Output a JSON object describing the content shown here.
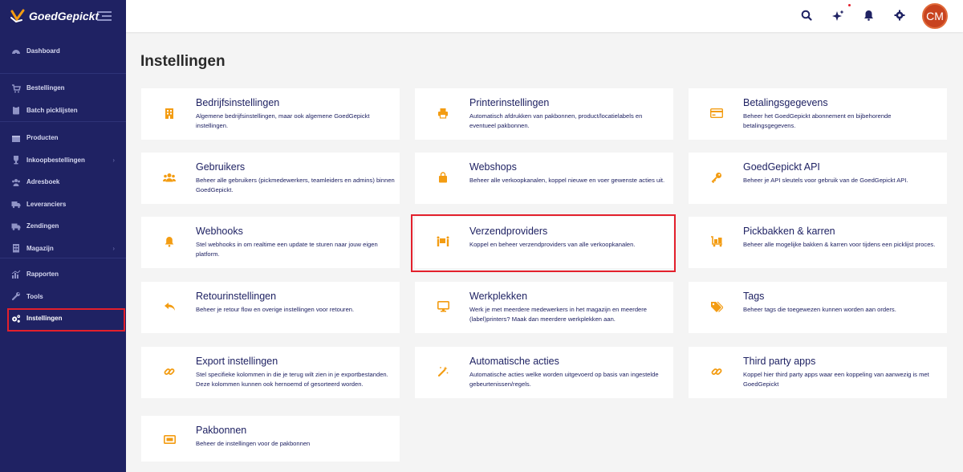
{
  "app": {
    "logo_text": "GoedGepickt"
  },
  "sidebar": {
    "groups": [
      [
        {
          "label": "Dashboard",
          "icon": "dashboard-icon"
        }
      ],
      [
        {
          "label": "Bestellingen",
          "icon": "cart-icon"
        },
        {
          "label": "Batch picklijsten",
          "icon": "clipboard-icon"
        }
      ],
      [
        {
          "label": "Producten",
          "icon": "box-icon"
        },
        {
          "label": "Inkoopbestellingen",
          "icon": "trophy-icon"
        },
        {
          "label": "Adresboek",
          "icon": "users-icon"
        },
        {
          "label": "Leveranciers",
          "icon": "truck-icon"
        },
        {
          "label": "Zendingen",
          "icon": "shipping-icon"
        },
        {
          "label": "Magazijn",
          "icon": "warehouse-icon"
        }
      ],
      [
        {
          "label": "Rapporten",
          "icon": "chart-icon"
        },
        {
          "label": "Tools",
          "icon": "wrench-icon"
        },
        {
          "label": "Instellingen",
          "icon": "cogs-icon"
        }
      ]
    ]
  },
  "header": {
    "avatar_initials": "CM"
  },
  "main": {
    "title": "Instellingen",
    "cards": [
      {
        "title": "Bedrijfsinstellingen",
        "desc": "Algemene bedrijfsinstellingen, maar ook algemene GoedGepickt instellingen.",
        "icon": "building-icon"
      },
      {
        "title": "Printerinstellingen",
        "desc": "Automatisch afdrukken van pakbonnen, product/locatielabels en eventueel pakbonnen.",
        "icon": "printer-icon"
      },
      {
        "title": "Betalingsgegevens",
        "desc": "Beheer het GoedGepickt abonnement en bijbehorende betalingsgegevens.",
        "icon": "credit-card-icon"
      },
      {
        "title": "Gebruikers",
        "desc": "Beheer alle gebruikers (pickmedewerkers, teamleiders en admins) binnen GoedGepickt.",
        "icon": "users-icon"
      },
      {
        "title": "Webshops",
        "desc": "Beheer alle verkoopkanalen, koppel nieuwe en voer gewenste acties uit.",
        "icon": "shopping-bag-icon"
      },
      {
        "title": "GoedGepickt API",
        "desc": "Beheer je API sleutels voor gebruik van de GoedGepickt API.",
        "icon": "key-icon"
      },
      {
        "title": "Webhooks",
        "desc": "Stel webhooks in om realtime een update te sturen naar jouw eigen platform.",
        "icon": "bell-icon"
      },
      {
        "title": "Verzendproviders",
        "desc": "Koppel en beheer verzendproviders van alle verkoopkanalen.",
        "icon": "people-carry-icon"
      },
      {
        "title": "Pickbakken & karren",
        "desc": "Beheer alle mogelijke bakken & karren voor tijdens een picklijst proces.",
        "icon": "dolly-icon"
      },
      {
        "title": "Retourinstellingen",
        "desc": "Beheer je retour flow en overige instellingen voor retouren.",
        "icon": "reply-icon"
      },
      {
        "title": "Werkplekken",
        "desc": "Werk je met meerdere medewerkers in het magazijn en meerdere (label)printers? Maak dan meerdere werkplekken aan.",
        "icon": "desktop-icon"
      },
      {
        "title": "Tags",
        "desc": "Beheer tags die toegewezen kunnen worden aan orders.",
        "icon": "tags-icon"
      },
      {
        "title": "Export instellingen",
        "desc": "Stel specifieke kolommen in die je terug wilt zien in je exportbestanden. Deze kolommen kunnen ook hernoemd of gesorteerd worden.",
        "icon": "link-icon"
      },
      {
        "title": "Automatische acties",
        "desc": "Automatische acties welke worden uitgevoerd op basis van ingestelde gebeurtenissen/regels.",
        "icon": "magic-wand-icon"
      },
      {
        "title": "Third party apps",
        "desc": "Koppel hier third party apps waar een koppeling van aanwezig is met GoedGepickt",
        "icon": "link-icon"
      },
      {
        "title": "Pakbonnen",
        "desc": "Beheer de instellingen voor de pakbonnen",
        "icon": "receipt-icon"
      }
    ]
  },
  "colors": {
    "sidebar_bg": "#1f2263",
    "accent": "#f39c12",
    "highlight": "#e3202c",
    "avatar": "#c8431f"
  }
}
